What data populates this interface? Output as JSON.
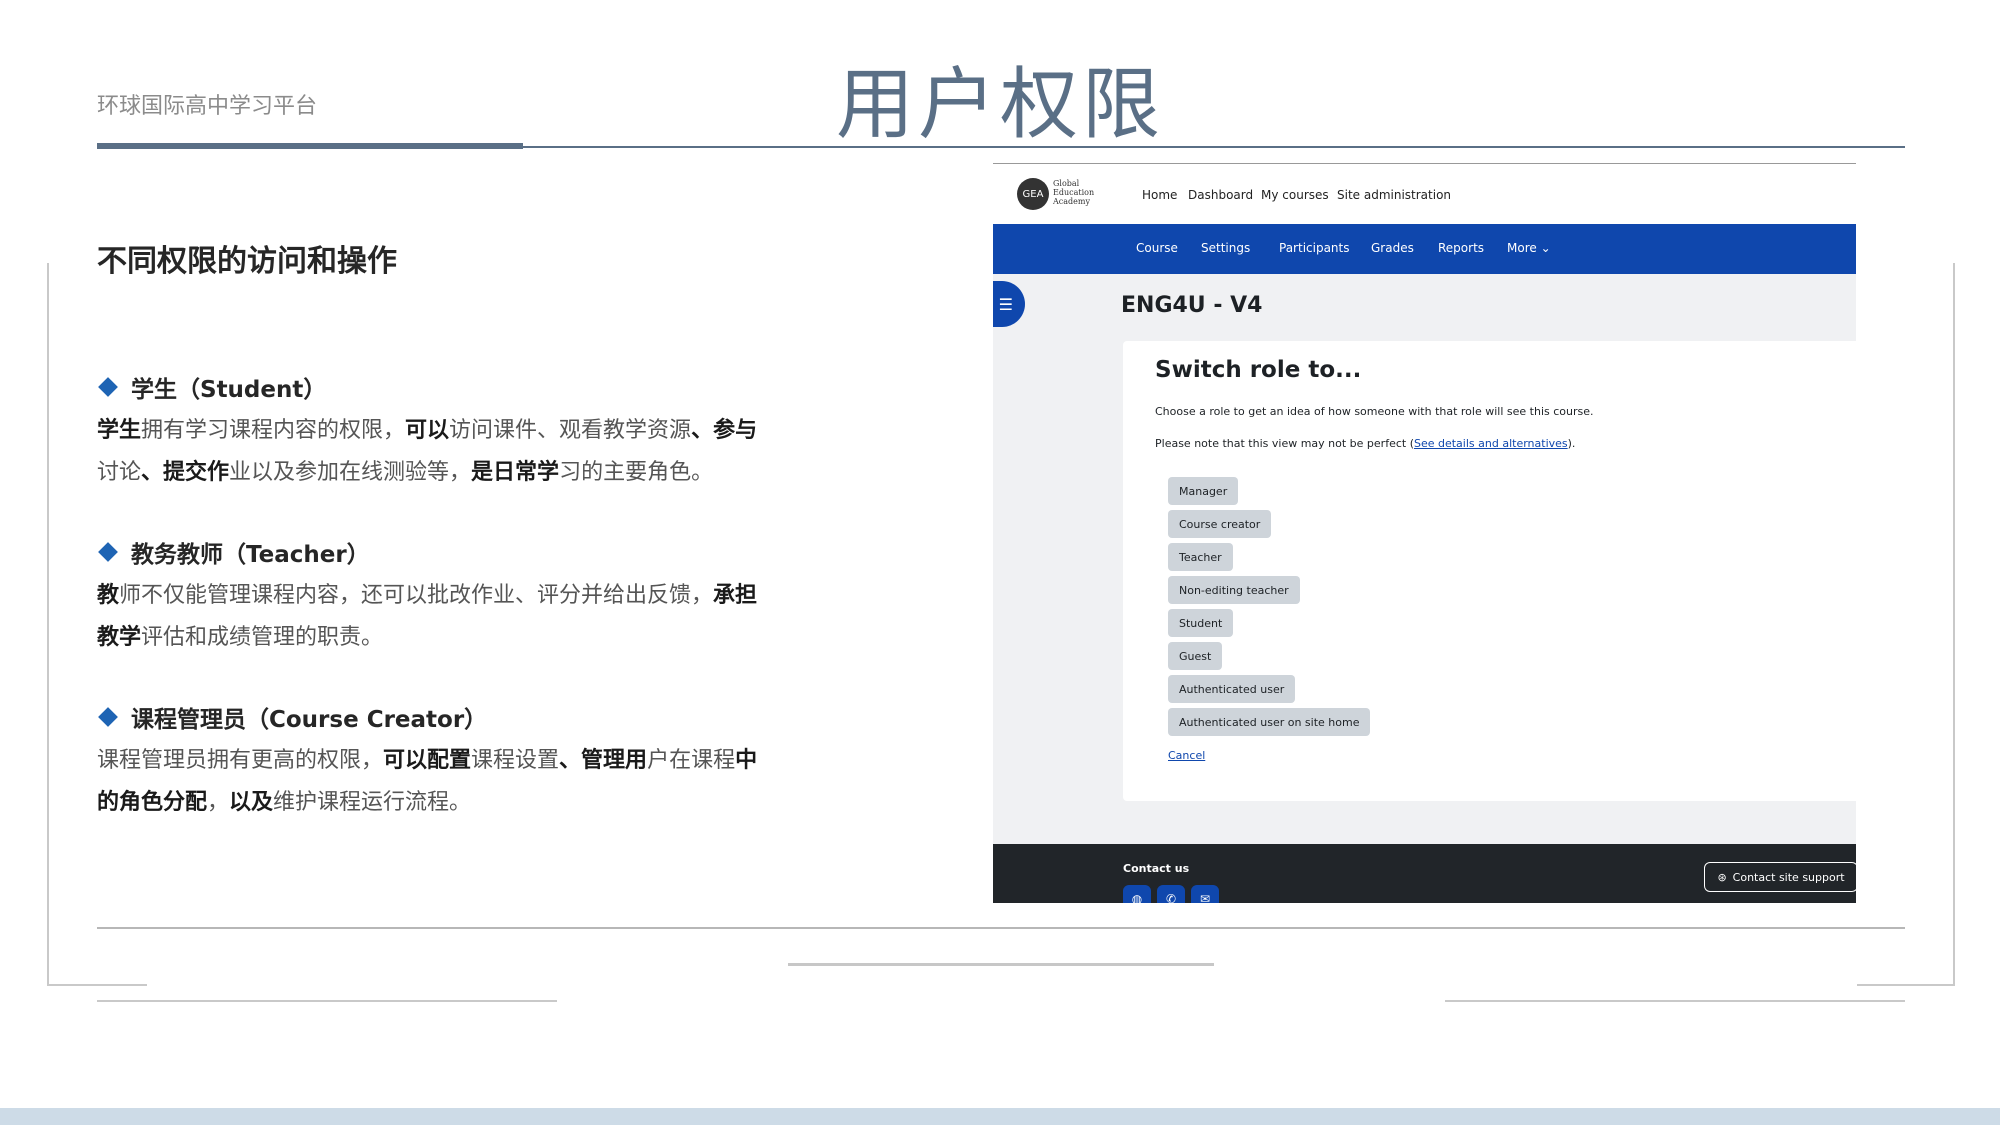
{
  "slide": {
    "brand": "环球国际高中学习平台",
    "title": "用户权限",
    "section_heading": "不同权限的访问和操作"
  },
  "roles": {
    "student": {
      "heading": "学生（Student）",
      "parts": [
        {
          "t": "学生",
          "b": true
        },
        {
          "t": "拥有学习课程内容的权限，",
          "b": false
        },
        {
          "t": "可以",
          "b": true
        },
        {
          "t": "访问课件、观看教学资源",
          "b": false
        },
        {
          "t": "、参与",
          "b": true
        },
        {
          "t": "讨论",
          "b": false
        },
        {
          "t": "、提交作",
          "b": true
        },
        {
          "t": "业以及参加在线测验等，",
          "b": false
        },
        {
          "t": "是日常学",
          "b": true
        },
        {
          "t": "习的主要角色。",
          "b": false
        }
      ]
    },
    "teacher": {
      "heading": "教务教师（Teacher）",
      "parts": [
        {
          "t": "教",
          "b": true
        },
        {
          "t": "师不仅能管理课程内容，还可以批改作业、评分并给出反馈，",
          "b": false
        },
        {
          "t": "承担教学",
          "b": true
        },
        {
          "t": "评估和成绩管理的职责。",
          "b": false
        }
      ]
    },
    "creator": {
      "heading": "课程管理员（Course Creator）",
      "parts": [
        {
          "t": "课程管理员拥有更高的权限，",
          "b": false
        },
        {
          "t": "可以配置",
          "b": true
        },
        {
          "t": "课程设置",
          "b": false
        },
        {
          "t": "、管理用",
          "b": true
        },
        {
          "t": "户在课程",
          "b": false
        },
        {
          "t": "中的角色分配",
          "b": true
        },
        {
          "t": "，",
          "b": false
        },
        {
          "t": "以及",
          "b": true
        },
        {
          "t": "维护课程运行流程。",
          "b": false
        }
      ]
    }
  },
  "screenshot": {
    "logo_text": "Global Education Academy",
    "logo_mark": "GEA",
    "top_nav": [
      "Home",
      "Dashboard",
      "My courses",
      "Site administration"
    ],
    "sub_nav": [
      "Course",
      "Settings",
      "Participants",
      "Grades",
      "Reports",
      "More"
    ],
    "course_title": "ENG4U - V4",
    "card": {
      "title": "Switch role to...",
      "intro": "Choose a role to get an idea of how someone with that role will see this course.",
      "note_prefix": "Please note that this view may not be perfect (",
      "note_link": "See details and alternatives",
      "note_suffix": ").",
      "roles": [
        "Manager",
        "Course creator",
        "Teacher",
        "Non-editing teacher",
        "Student",
        "Guest",
        "Authenticated user",
        "Authenticated user on site home"
      ],
      "cancel": "Cancel"
    },
    "footer": {
      "contact_label": "Contact us",
      "support_button": "Contact site support"
    },
    "colors": {
      "brand_blue": "#0f47ad",
      "footer_dark": "#212529"
    }
  }
}
